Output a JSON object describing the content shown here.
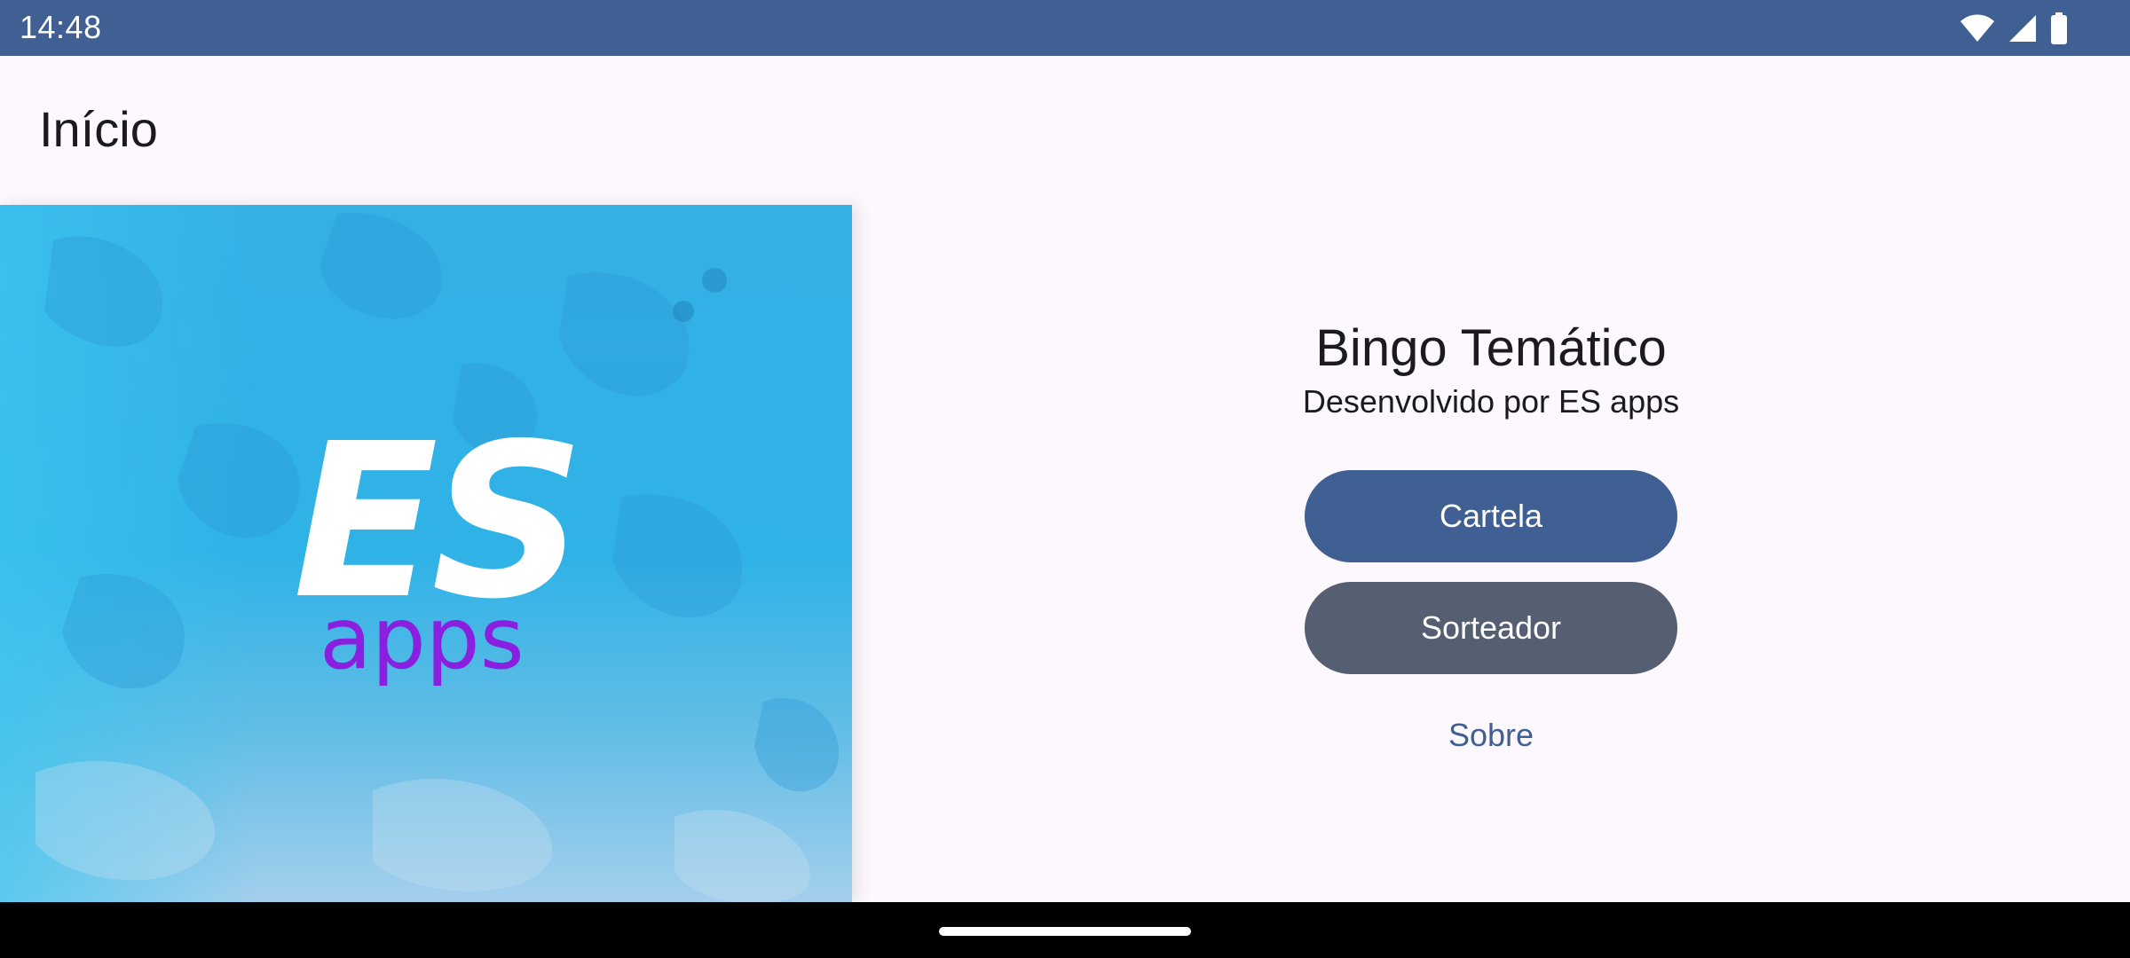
{
  "status_bar": {
    "time": "14:48",
    "icons": [
      "wifi-icon",
      "cell-signal-icon",
      "battery-icon"
    ],
    "color": "#405f92"
  },
  "app_bar": {
    "title": "Início"
  },
  "hero": {
    "logo_main": "ES",
    "logo_sub": "apps",
    "logo_main_color": "#ffffff",
    "logo_sub_color": "#8a1fe0"
  },
  "main": {
    "app_name": "Bingo Temático",
    "subtitle": "Desenvolvido por ES apps",
    "primary_button": "Cartela",
    "secondary_button": "Sorteador",
    "text_button": "Sobre"
  },
  "colors": {
    "primary": "#405f92",
    "secondary": "#565f71",
    "background": "#fcf8fd"
  }
}
